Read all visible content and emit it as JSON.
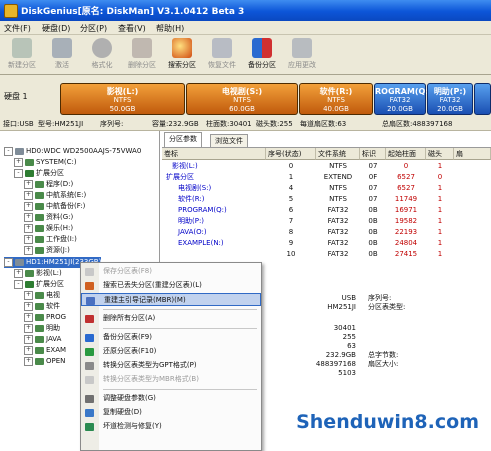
{
  "window": {
    "title": "DiskGenius[原名: DiskMan] V3.1.0412 Beta 3"
  },
  "menu": [
    "文件(F)",
    "硬盘(D)",
    "分区(P)",
    "查看(V)",
    "帮助(H)"
  ],
  "toolbar": [
    {
      "label": "新建分区",
      "icon": "new-partition-icon",
      "enabled": false
    },
    {
      "label": "激活",
      "icon": "activate-icon",
      "enabled": false
    },
    {
      "label": "格式化",
      "icon": "format-icon",
      "enabled": false
    },
    {
      "label": "删除分区",
      "icon": "delete-partition-icon",
      "enabled": false
    },
    {
      "label": "搜索分区",
      "icon": "search-partition-icon",
      "enabled": true
    },
    {
      "label": "恢复文件",
      "icon": "recover-files-icon",
      "enabled": false
    },
    {
      "label": "备份分区",
      "icon": "backup-partition-icon",
      "enabled": true
    },
    {
      "label": "应用更改",
      "icon": "apply-changes-icon",
      "enabled": false
    }
  ],
  "diskbar": {
    "disk_label": "硬盘 1",
    "segments": [
      {
        "name": "影视(L:)",
        "fs": "NTFS",
        "size": "50.0GB",
        "color": "orange"
      },
      {
        "name": "电视剧(S:)",
        "fs": "NTFS",
        "size": "60.0GB",
        "color": "orange"
      },
      {
        "name": "软件(R:)",
        "fs": "NTFS",
        "size": "40.0GB",
        "color": "orange"
      },
      {
        "name": "ROGRAM(Q:)",
        "fs": "FAT32",
        "size": "20.0GB",
        "color": "blue"
      },
      {
        "name": "明助(P:)",
        "fs": "FAT32",
        "size": "20.0GB",
        "color": "blue"
      }
    ]
  },
  "infoline": {
    "interface": "接口:USB",
    "model": "型号:HM251JI",
    "serial": "序列号:",
    "capacity": "容量:232.9GB",
    "cylinders": "柱面数:30401",
    "heads": "磁头数:255",
    "sectors": "每道扇区数:63",
    "total_sectors": "总扇区数:488397168"
  },
  "tree": [
    {
      "text": "HD0:WDC WD2500AAJS-75VWA0",
      "level": 0,
      "exp": "-",
      "icon": "disk",
      "selected": false
    },
    {
      "text": "SYSTEM(C:)",
      "level": 1,
      "exp": "+",
      "icon": "part",
      "selected": false
    },
    {
      "text": "扩展分区",
      "level": 1,
      "exp": "-",
      "icon": "ext",
      "selected": false
    },
    {
      "text": "程序(D:)",
      "level": 2,
      "exp": "+",
      "icon": "part",
      "selected": false
    },
    {
      "text": "中航系统(E:)",
      "level": 2,
      "exp": "+",
      "icon": "part",
      "selected": false
    },
    {
      "text": "中航备份(F:)",
      "level": 2,
      "exp": "+",
      "icon": "part",
      "selected": false
    },
    {
      "text": "资料(G:)",
      "level": 2,
      "exp": "+",
      "icon": "part",
      "selected": false
    },
    {
      "text": "娱乐(H:)",
      "level": 2,
      "exp": "+",
      "icon": "part",
      "selected": false
    },
    {
      "text": "工作盘(I:)",
      "level": 2,
      "exp": "+",
      "icon": "part",
      "selected": false
    },
    {
      "text": "资源(J:)",
      "level": 2,
      "exp": "+",
      "icon": "part",
      "selected": false
    },
    {
      "text": "HD1:HM251JI(233GB)",
      "level": 0,
      "exp": "-",
      "icon": "disk",
      "selected": true
    },
    {
      "text": "影视(L:)",
      "level": 1,
      "exp": "+",
      "icon": "part",
      "selected": false
    },
    {
      "text": "扩展分区",
      "level": 1,
      "exp": "-",
      "icon": "ext",
      "selected": false
    },
    {
      "text": "电视",
      "level": 2,
      "exp": "+",
      "icon": "part",
      "selected": false
    },
    {
      "text": "软件",
      "level": 2,
      "exp": "+",
      "icon": "part",
      "selected": false
    },
    {
      "text": "PROG",
      "level": 2,
      "exp": "+",
      "icon": "part",
      "selected": false
    },
    {
      "text": "明助",
      "level": 2,
      "exp": "+",
      "icon": "part",
      "selected": false
    },
    {
      "text": "JAVA",
      "level": 2,
      "exp": "+",
      "icon": "part",
      "selected": false
    },
    {
      "text": "EXAM",
      "level": 2,
      "exp": "+",
      "icon": "part",
      "selected": false
    },
    {
      "text": "OPEN",
      "level": 2,
      "exp": "+",
      "icon": "part",
      "selected": false
    }
  ],
  "tabs": [
    "分区参数",
    "浏览文件"
  ],
  "grid": {
    "headers": [
      "卷标",
      "序号(状态)",
      "文件系统",
      "标识",
      "起始柱面",
      "磁头",
      "扇"
    ],
    "rows": [
      {
        "label": "影视(L:)",
        "indent": 1,
        "num": "0",
        "fs": "NTFS",
        "id": "07",
        "start": "0",
        "head": "1"
      },
      {
        "label": "扩展分区",
        "indent": 0,
        "num": "1",
        "fs": "EXTEND",
        "id": "0F",
        "start": "6527",
        "head": "0"
      },
      {
        "label": "电视剧(S:)",
        "indent": 2,
        "num": "4",
        "fs": "NTFS",
        "id": "07",
        "start": "6527",
        "head": "1"
      },
      {
        "label": "软件(R:)",
        "indent": 2,
        "num": "5",
        "fs": "NTFS",
        "id": "07",
        "start": "11749",
        "head": "1"
      },
      {
        "label": "PROGRAM(Q:)",
        "indent": 2,
        "num": "6",
        "fs": "FAT32",
        "id": "0B",
        "start": "16971",
        "head": "1"
      },
      {
        "label": "明助(P:)",
        "indent": 2,
        "num": "7",
        "fs": "FAT32",
        "id": "0B",
        "start": "19582",
        "head": "1"
      },
      {
        "label": "JAVA(O:)",
        "indent": 2,
        "num": "8",
        "fs": "FAT32",
        "id": "0B",
        "start": "22193",
        "head": "1"
      },
      {
        "label": "EXAMPLE(N:)",
        "indent": 2,
        "num": "9",
        "fs": "FAT32",
        "id": "0B",
        "start": "24804",
        "head": "1"
      },
      {
        "label": "",
        "indent": 2,
        "num": "10",
        "fs": "FAT32",
        "id": "0B",
        "start": "27415",
        "head": "1"
      }
    ]
  },
  "info_panel": {
    "col1": [
      "USB",
      "HM251JI",
      "",
      "30401",
      "255",
      "63",
      "232.9GB",
      "488397168",
      "5103"
    ],
    "col2": [
      "序列号:",
      "分区表类型:",
      "",
      "",
      "",
      "",
      "总字节数:",
      "扇区大小:",
      ""
    ]
  },
  "context_menu": {
    "items": [
      {
        "label": "保存分区表(F8)",
        "enabled": false,
        "icon": "save-icon"
      },
      {
        "label": "搜索已丢失分区(重建分区表)(L)",
        "enabled": true,
        "icon": "search-icon"
      },
      {
        "label": "重建主引导记录(MBR)(M)",
        "enabled": true,
        "icon": "mbr-icon",
        "highlight": true
      },
      {
        "sep": true
      },
      {
        "label": "删除所有分区(A)",
        "enabled": true,
        "icon": "delete-icon"
      },
      {
        "sep": true
      },
      {
        "label": "备份分区表(F9)",
        "enabled": true,
        "icon": "backup-icon"
      },
      {
        "label": "还原分区表(F10)",
        "enabled": true,
        "icon": "restore-icon"
      },
      {
        "label": "转换分区表类型为GPT格式(P)",
        "enabled": true,
        "icon": "convert-icon"
      },
      {
        "label": "转换分区表类型为MBR格式(B)",
        "enabled": false,
        "icon": "convert-icon"
      },
      {
        "sep": true
      },
      {
        "label": "调整硬盘参数(G)",
        "enabled": true,
        "icon": "adjust-icon"
      },
      {
        "label": "复制硬盘(D)",
        "enabled": true,
        "icon": "copy-icon"
      },
      {
        "label": "坏道检测与修复(Y)",
        "enabled": true,
        "icon": "check-icon"
      }
    ]
  },
  "watermark": "Shenduwin8.com"
}
